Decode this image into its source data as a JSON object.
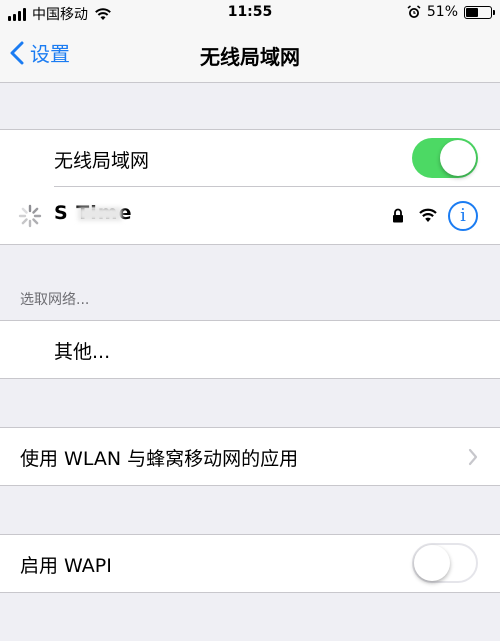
{
  "status_bar": {
    "carrier": "中国移动",
    "time": "11:55",
    "battery_percent": "51%",
    "battery_level": 0.51,
    "icons": [
      "signal-icon",
      "wifi-icon",
      "alarm-icon",
      "battery-icon"
    ]
  },
  "nav": {
    "back_label": "设置",
    "title": "无线局域网"
  },
  "wifi_section": {
    "toggle_label": "无线局域网",
    "toggle_on": true,
    "network_name": "S    Time",
    "network_icons": [
      "lock-icon",
      "wifi-icon",
      "info-icon"
    ],
    "info_glyph": "i"
  },
  "choose_section": {
    "header": "选取网络...",
    "other_label": "其他..."
  },
  "wlan_apps": {
    "label": "使用 WLAN 与蜂窝移动网的应用"
  },
  "wapi": {
    "label": "启用 WAPI",
    "toggle_on": false
  },
  "colors": {
    "accent": "#1b7cf2",
    "toggle_on": "#4cd964",
    "background": "#efeff4"
  }
}
